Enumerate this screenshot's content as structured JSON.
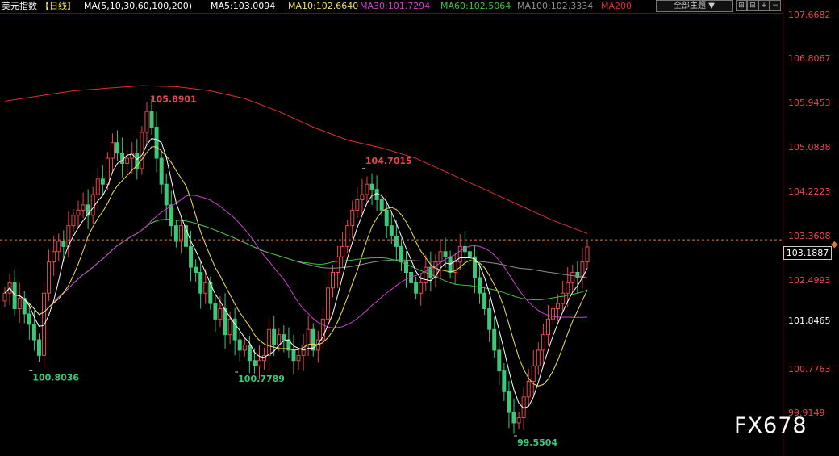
{
  "header": {
    "instrument": "美元指数",
    "period": "【日线】",
    "ma_params": "MA(5,10,30,60,100,200)",
    "ma5": "MA5:103.0094",
    "ma10": "MA10:102.6640",
    "ma30": "MA30:101.7294",
    "ma60": "MA60:102.5064",
    "ma100": "MA100:102.3334",
    "ma200": "MA200",
    "theme_select": "全部主题 ▼",
    "toolbar_icons": [
      "crosshair-icon",
      "grid-icon",
      "zoom-in-icon",
      "zoom-out-icon",
      "list-icon"
    ]
  },
  "colors": {
    "ma5": "#ffffff",
    "ma10": "#f0e060",
    "ma30": "#d040d0",
    "ma60": "#40c040",
    "ma100": "#909090",
    "ma200": "#e03030",
    "up": "#e8484c",
    "down": "#3cc878",
    "current_price_line": "#e87b2a"
  },
  "axis": {
    "ticks": [
      "107.6682",
      "106.8067",
      "105.9453",
      "105.0838",
      "104.2223",
      "103.3608",
      "102.4993",
      "101.8465",
      "100.7763",
      "99.9149"
    ],
    "current_price": "103.1887"
  },
  "annotations": {
    "high1": "105.8901",
    "high2": "104.7015",
    "low1": "100.8036",
    "low2": "100.7789",
    "low3": "99.5504"
  },
  "watermark": "FX678",
  "chart_data": {
    "type": "candlestick",
    "title": "美元指数【日线】",
    "ylim": [
      99.55,
      107.67
    ],
    "ma_legend": [
      "MA5:103.0094",
      "MA10:102.6640",
      "MA30:101.7294",
      "MA60:102.5064",
      "MA100:102.3334",
      "MA200"
    ],
    "candle_count": 120,
    "series": [
      {
        "name": "close",
        "values": [
          102.3,
          102.5,
          102.0,
          102.2,
          101.9,
          101.7,
          101.4,
          101.1,
          102.3,
          102.9,
          103.1,
          103.3,
          103.2,
          103.6,
          103.8,
          103.9,
          104.0,
          103.8,
          104.2,
          104.5,
          104.4,
          104.9,
          105.2,
          105.0,
          104.8,
          104.9,
          105.0,
          104.7,
          105.4,
          105.8,
          105.5,
          104.9,
          104.4,
          104.0,
          103.6,
          103.3,
          103.6,
          103.2,
          102.8,
          102.7,
          102.3,
          102.5,
          102.1,
          101.8,
          102.0,
          101.5,
          101.8,
          101.4,
          101.2,
          101.3,
          101.0,
          100.9,
          101.0,
          101.1,
          101.6,
          101.3,
          101.5,
          101.4,
          101.2,
          101.0,
          101.1,
          101.3,
          101.6,
          101.2,
          101.4,
          101.8,
          102.4,
          102.7,
          103.0,
          103.2,
          103.6,
          103.9,
          104.1,
          104.2,
          104.4,
          104.3,
          104.1,
          103.9,
          103.6,
          103.4,
          103.2,
          102.9,
          102.7,
          102.5,
          102.3,
          102.5,
          102.8,
          102.6,
          102.9,
          103.1,
          103.0,
          102.7,
          102.9,
          103.2,
          103.1,
          103.0,
          102.6,
          102.3,
          102.0,
          101.6,
          101.2,
          100.8,
          100.4,
          100.0,
          99.8,
          99.9,
          100.3,
          100.6,
          100.9,
          101.2,
          101.5,
          101.8,
          102.0,
          102.1,
          102.3,
          102.5,
          102.7,
          102.6,
          102.9,
          103.19
        ]
      },
      {
        "name": "MA200",
        "values": [
          106.0,
          106.1,
          106.2,
          106.25,
          106.3,
          106.28,
          106.2,
          106.05,
          105.8,
          105.5,
          105.25,
          105.1,
          104.9,
          104.6,
          104.3,
          104.0,
          103.7,
          103.45
        ]
      }
    ]
  }
}
